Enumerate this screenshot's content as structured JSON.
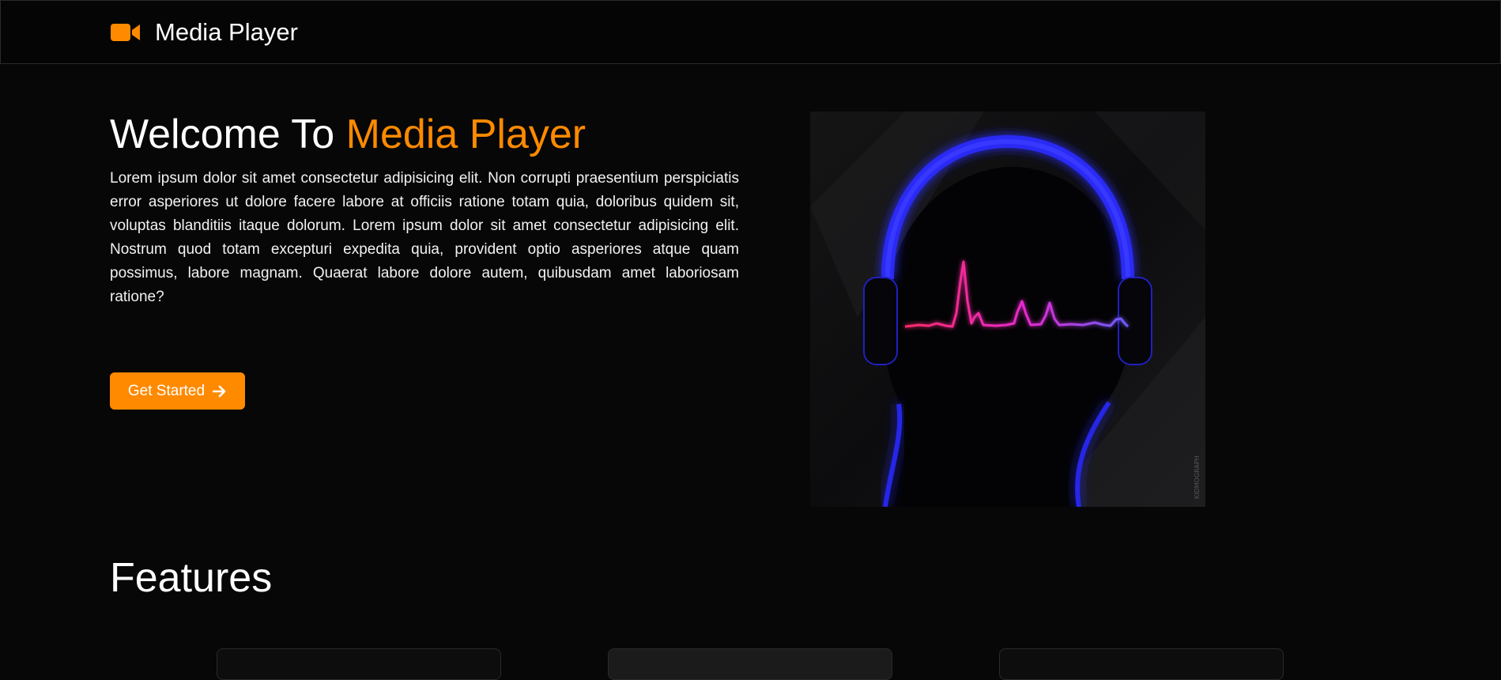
{
  "navbar": {
    "brand_icon": "video-camera-icon",
    "brand_name": "Media Player"
  },
  "hero": {
    "title_prefix": "Welcome To ",
    "title_accent": "Media Player",
    "description": "Lorem ipsum dolor sit amet consectetur adipisicing elit. Non corrupti praesentium perspiciatis error asperiores ut dolore facere labore at officiis ratione totam quia, doloribus quidem sit, voluptas blanditiis itaque dolorum. Lorem ipsum dolor sit amet consectetur adipisicing elit. Nostrum quod totam excepturi expedita quia, provident optio asperiores atque quam possimus, labore magnam. Quaerat labore dolore autem, quibusdam amet laboriosam ratione?",
    "cta_label": "Get Started",
    "cta_icon": "arrow-right-icon",
    "image_watermark": "KIDMOGRAPH"
  },
  "features": {
    "title": "Features"
  },
  "colors": {
    "accent": "#ff8a00",
    "background": "#070707",
    "neon_blue": "#2a2af5",
    "neon_pink": "#ff2a7a"
  }
}
